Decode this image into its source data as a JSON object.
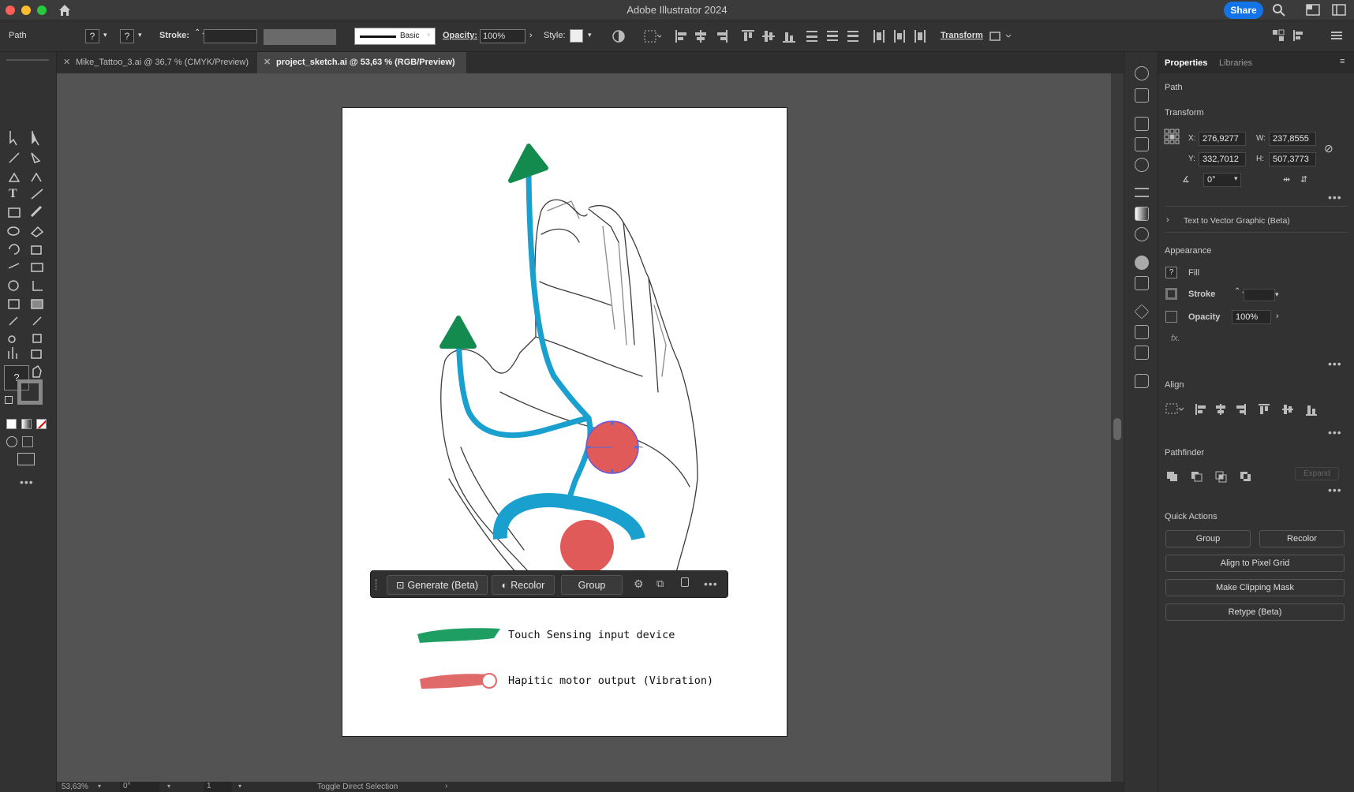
{
  "app": {
    "title": "Adobe Illustrator 2024",
    "share_label": "Share"
  },
  "control_bar": {
    "object_type": "Path",
    "fill_symbol": "?",
    "stroke_symbol": "?",
    "stroke_label": "Stroke:",
    "brush_label": "Basic",
    "opacity_label": "Opacity:",
    "opacity_value": "100%",
    "style_label": "Style:",
    "transform_label": "Transform"
  },
  "tabs": [
    {
      "label": "Mike_Tattoo_3.ai @ 36,7 % (CMYK/Preview)",
      "active": false
    },
    {
      "label": "project_sketch.ai @ 53,63 % (RGB/Preview)",
      "active": true
    }
  ],
  "tools": {
    "fill_symbol": "?"
  },
  "context_bar": {
    "generate_label": "Generate (Beta)",
    "recolor_label": "Recolor",
    "group_label": "Group"
  },
  "artwork": {
    "legend": [
      {
        "label": "Touch Sensing input device",
        "color": "#1f9e63"
      },
      {
        "label": "Hapitic motor output (Vibration)",
        "color": "#e06a6a"
      }
    ],
    "path_color": "#1aa0cf",
    "arrow_color": "#138a4e",
    "node_color": "#e05a5a"
  },
  "panel": {
    "tabs": [
      "Properties",
      "Libraries"
    ],
    "object_type": "Path",
    "transform": {
      "title": "Transform",
      "x_label": "X:",
      "x": "276,9277",
      "y_label": "Y:",
      "y": "332,7012",
      "w_label": "W:",
      "w": "237,8555",
      "h_label": "H:",
      "h": "507,3773",
      "angle": "0°"
    },
    "text_to_vector": "Text to Vector Graphic (Beta)",
    "appearance": {
      "title": "Appearance",
      "fill_label": "Fill",
      "fill_symbol": "?",
      "stroke_label": "Stroke",
      "opacity_label": "Opacity",
      "opacity_value": "100%",
      "fx_label": "fx."
    },
    "align_title": "Align",
    "pathfinder": {
      "title": "Pathfinder",
      "expand_label": "Expand"
    },
    "quick_actions": {
      "title": "Quick Actions",
      "group": "Group",
      "recolor": "Recolor",
      "align_pixel": "Align to Pixel Grid",
      "clipping_mask": "Make Clipping Mask",
      "retype": "Retype (Beta)"
    }
  },
  "status": {
    "zoom": "53,63%",
    "rotation": "0°",
    "artboard": "1",
    "tool_hint": "Toggle Direct Selection"
  }
}
